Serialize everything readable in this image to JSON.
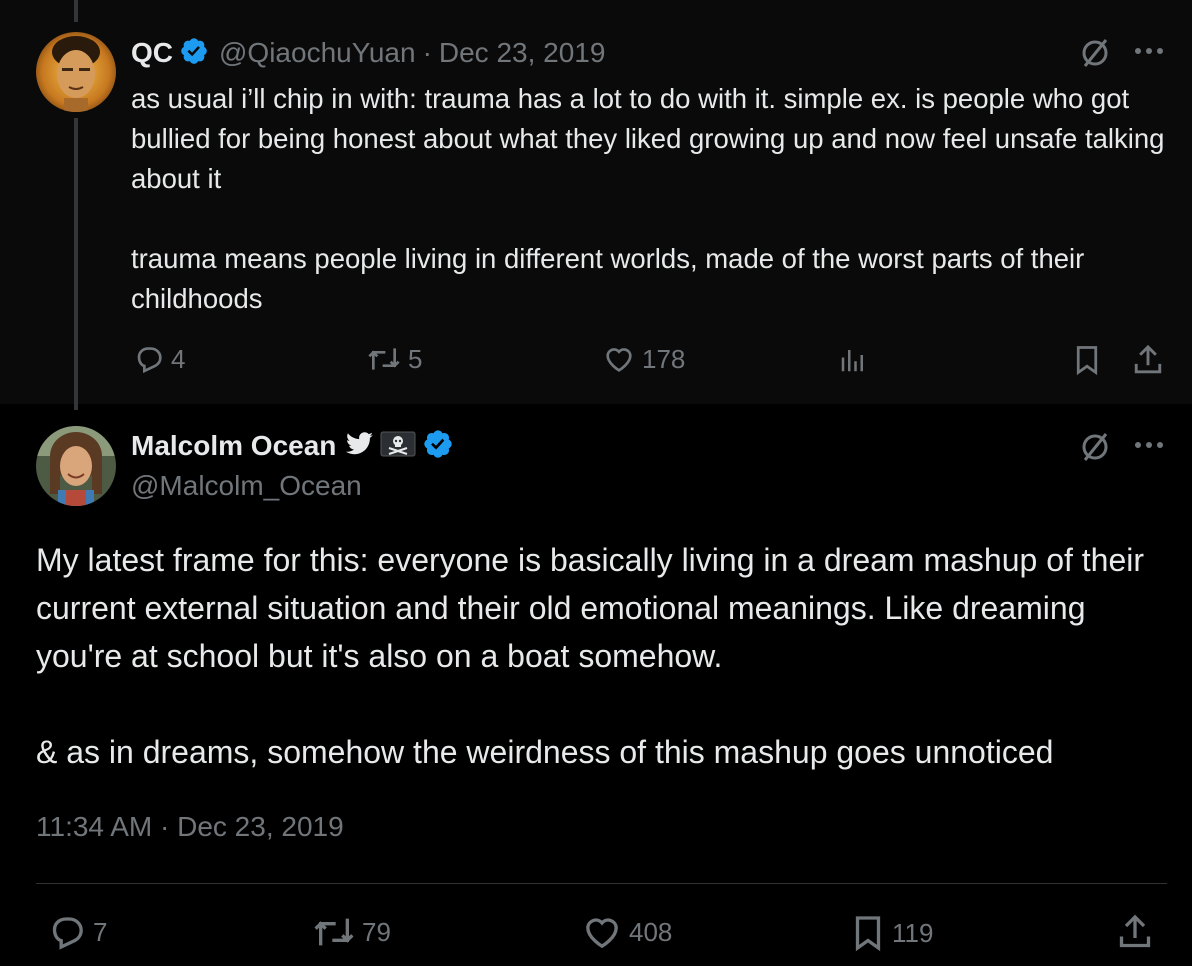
{
  "reply": {
    "display_name": "QC",
    "handle": "@QiaochuYuan",
    "separator": "·",
    "date": "Dec 23, 2019",
    "text": "as usual i’ll chip in with: trauma has a lot to do with it. simple ex. is people who got bullied for being honest about what they liked growing up and now feel unsafe talking about it\n\ntrauma means people living in different worlds, made of the worst parts of their childhoods",
    "actions": {
      "replies": "4",
      "retweets": "5",
      "likes": "178"
    }
  },
  "main": {
    "display_name": "Malcolm Ocean",
    "handle": "@Malcolm_Ocean",
    "name_emojis": [
      "bird-icon",
      "pirate-flag-icon"
    ],
    "text": "My latest frame for this: everyone is basically living in a dream mashup of their current external situation and their old emotional meanings. Like dreaming you're at school but it's also on a boat somehow.\n\n& as in dreams, somehow the weirdness of this mashup goes unnoticed",
    "timestamp": "11:34 AM · Dec 23, 2019",
    "actions": {
      "replies": "7",
      "retweets": "79",
      "likes": "408",
      "bookmarks": "119"
    }
  },
  "colors": {
    "verified": "#1d9bf0",
    "muted": "#71767b",
    "text": "#e7e9ea",
    "background": "#000000"
  }
}
